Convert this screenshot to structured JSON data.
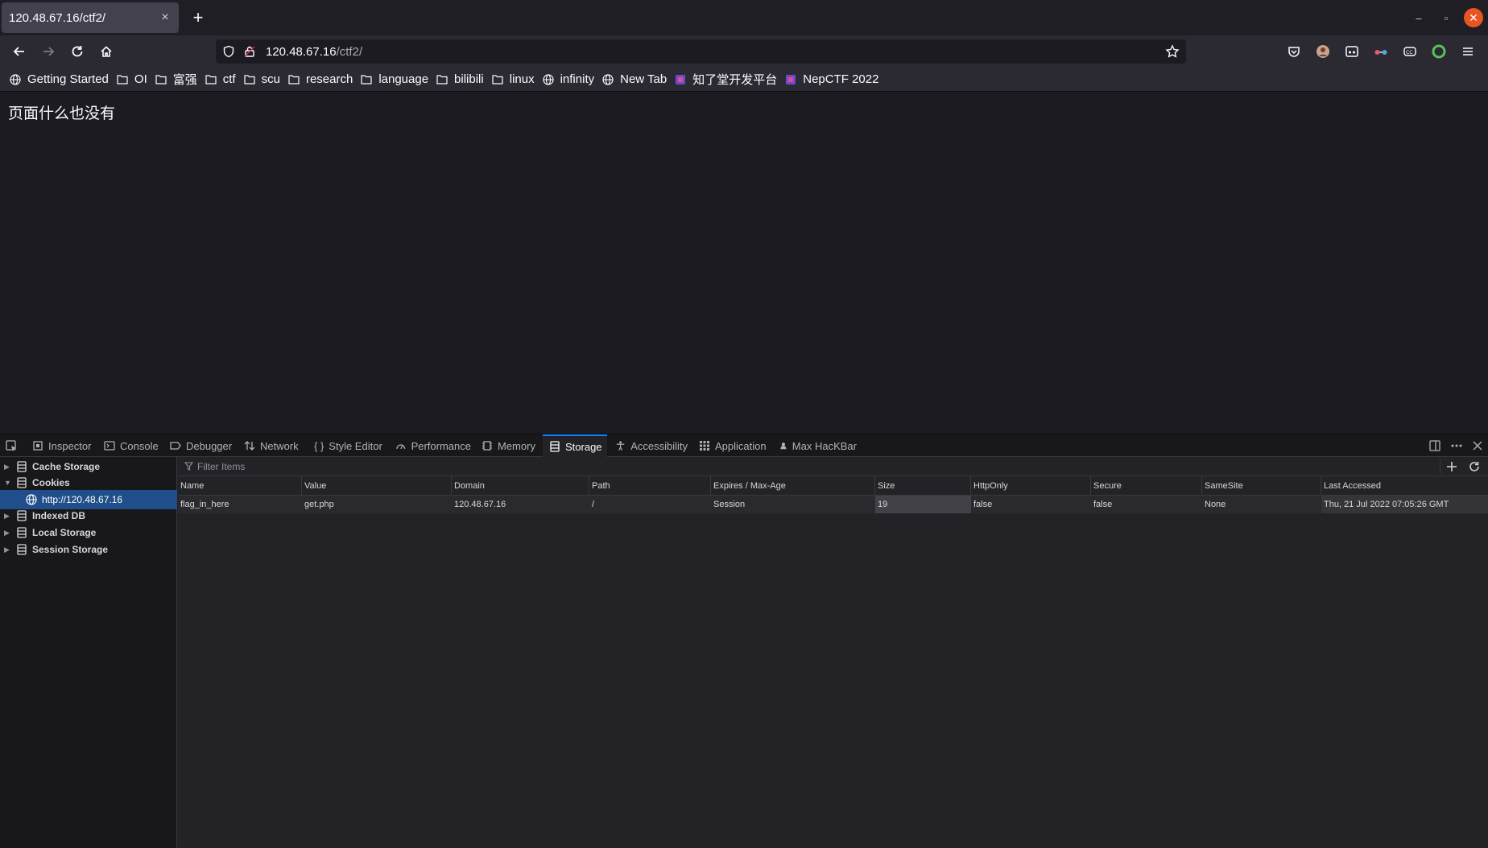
{
  "browser": {
    "tab": {
      "title": "120.48.67.16/ctf2/",
      "close_icon": "×"
    },
    "new_tab_icon": "+",
    "window_controls": {
      "minimize": "–",
      "maximize": "▫",
      "close": "✕"
    }
  },
  "navbar": {
    "url_host": "120.48.67.16",
    "url_path": "/ctf2/"
  },
  "bookmarks": [
    {
      "label": "Getting Started",
      "icon": "globe-icon"
    },
    {
      "label": "OI",
      "icon": "folder-icon"
    },
    {
      "label": "富强",
      "icon": "folder-icon"
    },
    {
      "label": "ctf",
      "icon": "folder-icon"
    },
    {
      "label": "scu",
      "icon": "folder-icon"
    },
    {
      "label": "research",
      "icon": "folder-icon"
    },
    {
      "label": "language",
      "icon": "folder-icon"
    },
    {
      "label": "bilibili",
      "icon": "folder-icon"
    },
    {
      "label": "linux",
      "icon": "folder-icon"
    },
    {
      "label": "infinity",
      "icon": "globe-icon"
    },
    {
      "label": "New Tab",
      "icon": "globe-icon"
    },
    {
      "label": "知了堂开发平台",
      "icon": "site-icon"
    },
    {
      "label": "NepCTF 2022",
      "icon": "site-icon"
    }
  ],
  "page": {
    "text": "页面什么也没有"
  },
  "devtools": {
    "tabs": {
      "inspector": "Inspector",
      "console": "Console",
      "debugger": "Debugger",
      "network": "Network",
      "style_editor": "Style Editor",
      "performance": "Performance",
      "memory": "Memory",
      "storage": "Storage",
      "accessibility": "Accessibility",
      "application": "Application",
      "hackbar": "Max HacKBar"
    },
    "active_tab": "Storage",
    "sidebar": {
      "cache_storage": "Cache Storage",
      "cookies": "Cookies",
      "cookie_host": "http://120.48.67.16",
      "indexed_db": "Indexed DB",
      "local_storage": "Local Storage",
      "session_storage": "Session Storage"
    },
    "filter_placeholder": "Filter Items",
    "columns": {
      "name": "Name",
      "value": "Value",
      "domain": "Domain",
      "path": "Path",
      "expires": "Expires / Max-Age",
      "size": "Size",
      "httponly": "HttpOnly",
      "secure": "Secure",
      "samesite": "SameSite",
      "last_accessed": "Last Accessed"
    },
    "row": {
      "name": "flag_in_here",
      "value": "get.php",
      "domain": "120.48.67.16",
      "path": "/",
      "expires": "Session",
      "size": "19",
      "httponly": "false",
      "secure": "false",
      "samesite": "None",
      "last_accessed": "Thu, 21 Jul 2022 07:05:26 GMT"
    }
  },
  "colors": {
    "accent": "#0a84ff",
    "selected": "#204e8a",
    "close_button": "#e95420"
  }
}
